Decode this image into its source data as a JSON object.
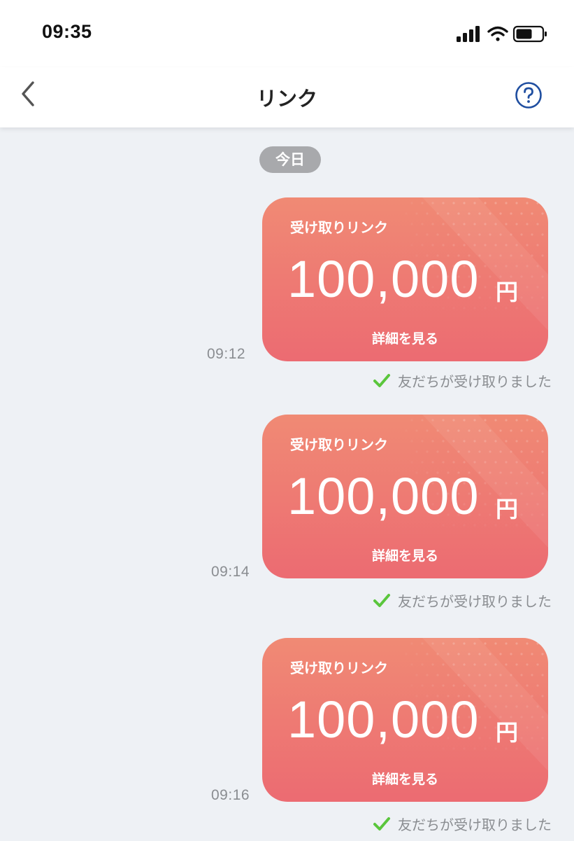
{
  "status_bar": {
    "time": "09:35"
  },
  "nav": {
    "title": "リンク"
  },
  "chat": {
    "date_label": "今日",
    "messages": [
      {
        "time": "09:12",
        "label": "受け取りリンク",
        "amount": "100,000",
        "currency": "円",
        "details": "詳細を見る",
        "receipt": "友だちが受け取りました"
      },
      {
        "time": "09:14",
        "label": "受け取りリンク",
        "amount": "100,000",
        "currency": "円",
        "details": "詳細を見る",
        "receipt": "友だちが受け取りました"
      },
      {
        "time": "09:16",
        "label": "受け取りリンク",
        "amount": "100,000",
        "currency": "円",
        "details": "詳細を見る",
        "receipt": "友だちが受け取りました"
      }
    ]
  },
  "colors": {
    "card_top": "#f08a74",
    "card_bottom": "#ec6b72",
    "check": "#5ac63c",
    "help_icon": "#1f4ea0"
  },
  "icons": {
    "back": "chevron-left-icon",
    "help": "help-circle-icon",
    "signal": "signal-icon",
    "wifi": "wifi-icon",
    "battery": "battery-icon",
    "check": "check-icon"
  }
}
